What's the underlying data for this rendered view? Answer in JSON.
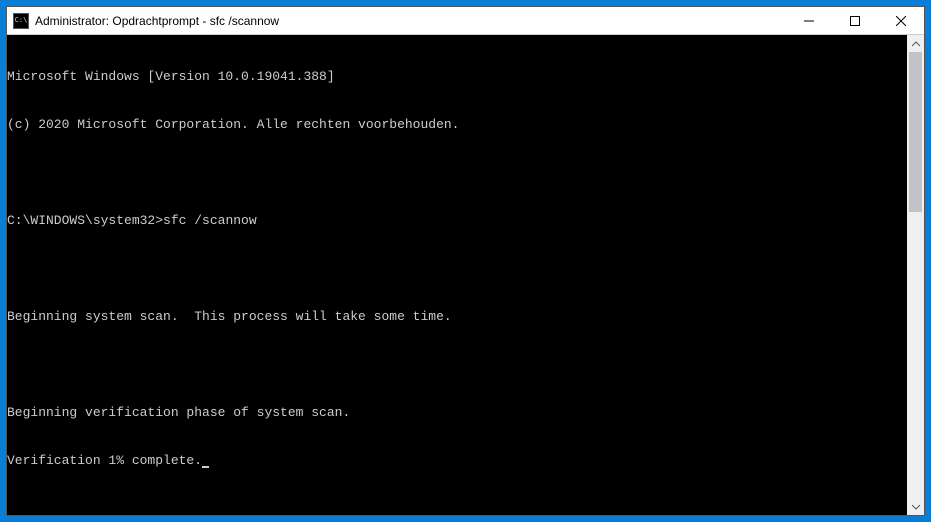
{
  "window": {
    "title": "Administrator: Opdrachtprompt - sfc  /scannow",
    "icon_glyph": "C:\\"
  },
  "console": {
    "line1": "Microsoft Windows [Version 10.0.19041.388]",
    "line2": "(c) 2020 Microsoft Corporation. Alle rechten voorbehouden.",
    "blank1": "",
    "prompt": "C:\\WINDOWS\\system32>",
    "command": "sfc /scannow",
    "blank2": "",
    "line3": "Beginning system scan.  This process will take some time.",
    "blank3": "",
    "line4": "Beginning verification phase of system scan.",
    "line5": "Verification 1% complete."
  }
}
